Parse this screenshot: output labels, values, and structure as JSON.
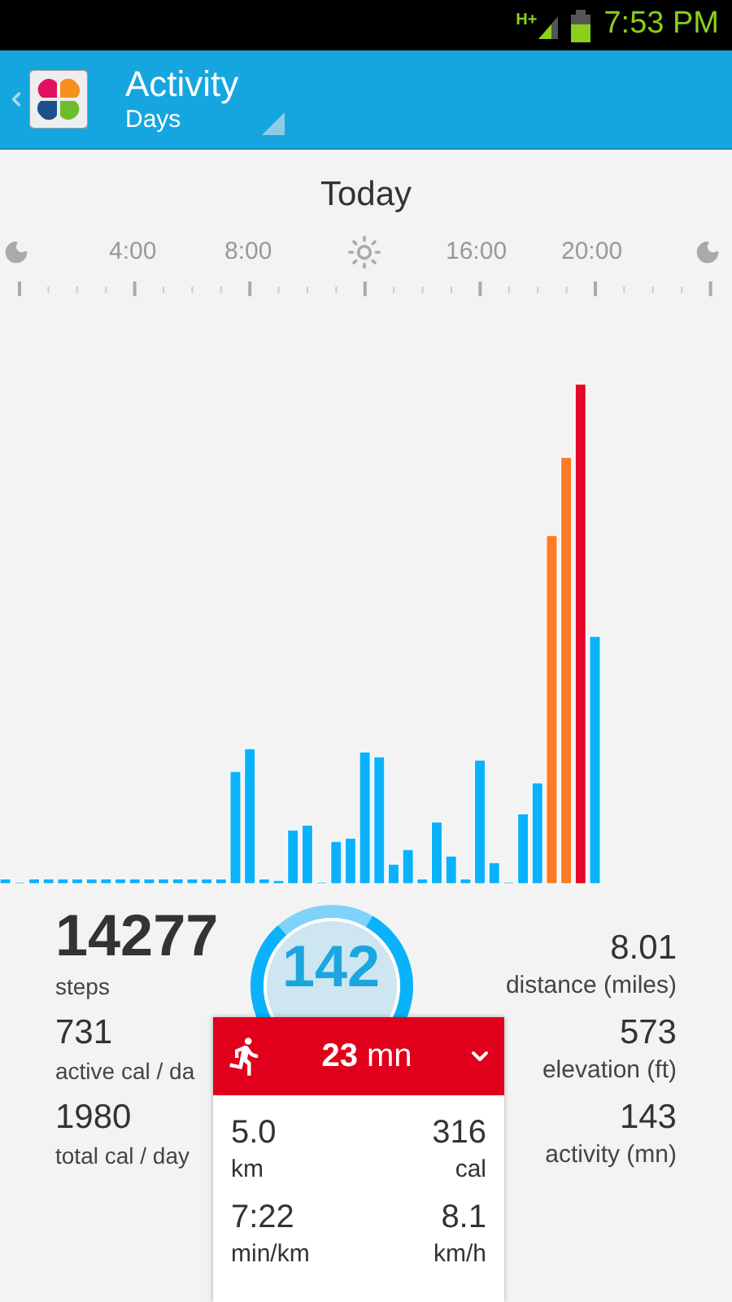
{
  "status_bar": {
    "network": "H+",
    "time": "7:53 PM"
  },
  "app_bar": {
    "title": "Activity",
    "subtitle": "Days"
  },
  "date_title": "Today",
  "time_axis": [
    "4:00",
    "8:00",
    "16:00",
    "20:00"
  ],
  "stats_left": [
    {
      "value": "14277",
      "label": "steps"
    },
    {
      "value": "731",
      "label": "active cal / da"
    },
    {
      "value": "1980",
      "label": "total cal / day"
    }
  ],
  "goal_ring": {
    "value": "142"
  },
  "stats_right": [
    {
      "value": "8.01",
      "label": "distance (miles)"
    },
    {
      "value": "573",
      "label": "elevation (ft)"
    },
    {
      "value": "143",
      "label": "activity (mn)"
    }
  ],
  "session_popup": {
    "duration": "**23** mn",
    "metrics": [
      {
        "value": "5.0",
        "unit": "km"
      },
      {
        "value": "316",
        "unit": "cal"
      },
      {
        "value": "7:22",
        "unit": "min/km"
      },
      {
        "value": "8.1",
        "unit": "km/h"
      }
    ]
  }
}
